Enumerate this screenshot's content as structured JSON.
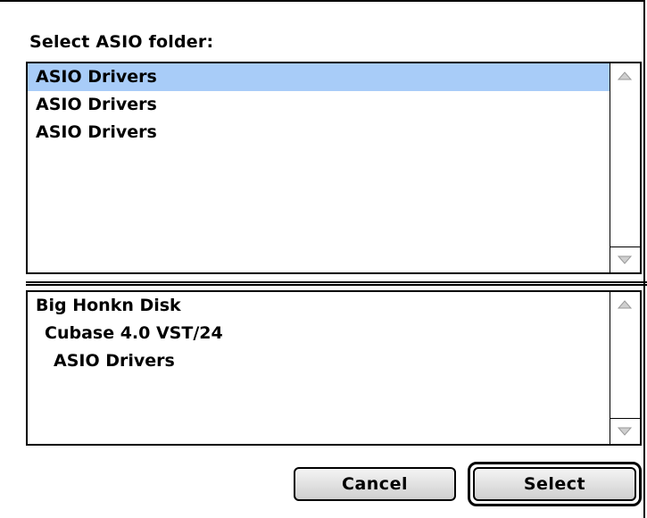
{
  "dialog": {
    "prompt": "Select ASIO folder:"
  },
  "folder_list": {
    "items": [
      {
        "label": "ASIO Drivers",
        "selected": true
      },
      {
        "label": "ASIO Drivers",
        "selected": false
      },
      {
        "label": "ASIO Drivers",
        "selected": false
      }
    ]
  },
  "path_list": {
    "items": [
      {
        "label": "Big Honkn Disk",
        "indent": 0
      },
      {
        "label": "Cubase 4.0 VST/24",
        "indent": 1
      },
      {
        "label": "ASIO Drivers",
        "indent": 2
      }
    ]
  },
  "buttons": {
    "cancel_label": "Cancel",
    "select_label": "Select"
  },
  "icons": {
    "scroll_up": "up-arrow-icon",
    "scroll_down": "down-arrow-icon"
  },
  "colors": {
    "selection": "#a8ccf8"
  }
}
